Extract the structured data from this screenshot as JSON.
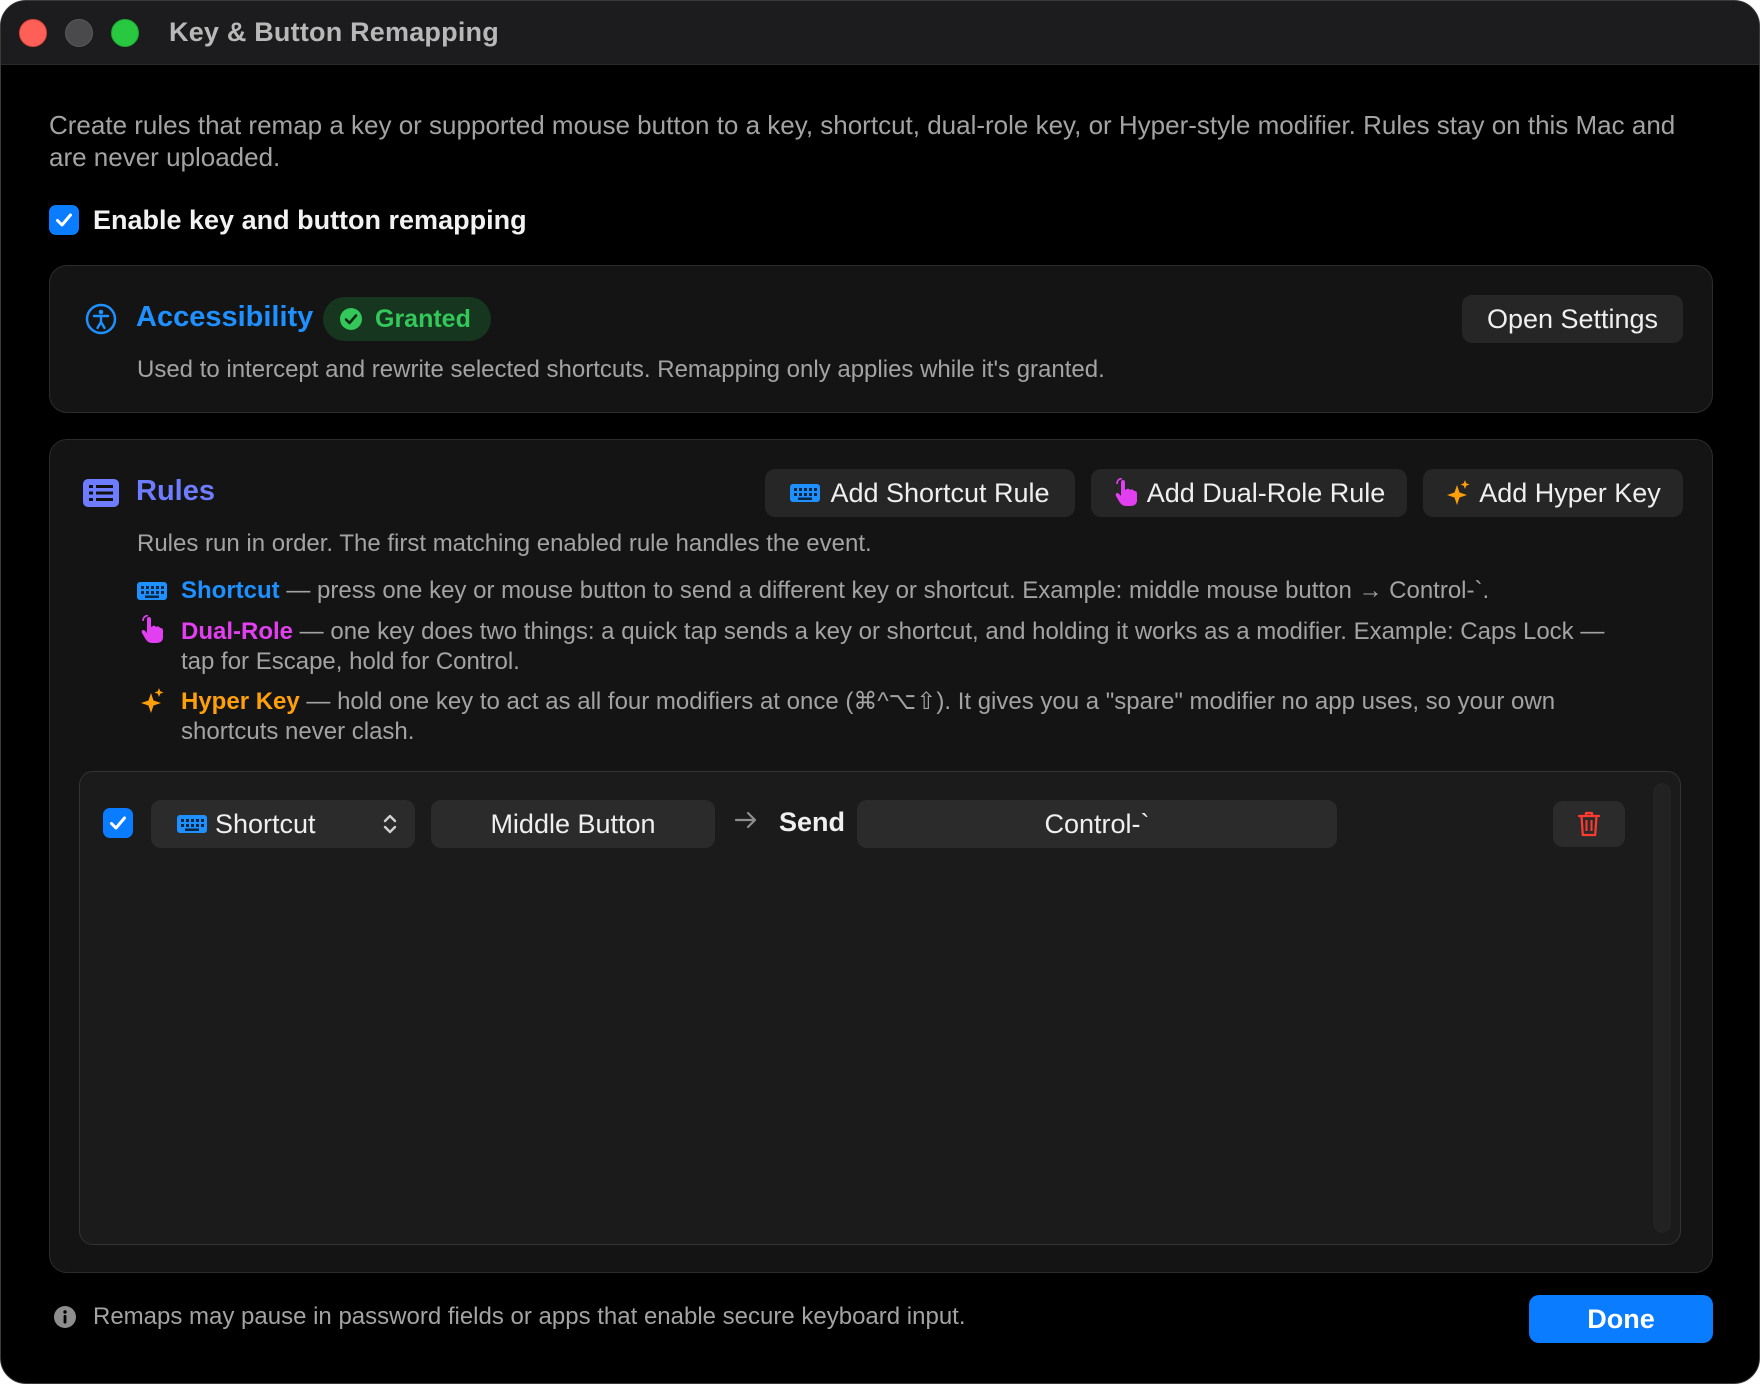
{
  "window": {
    "title": "Key & Button Remapping"
  },
  "intro": {
    "text": "Create rules that remap a key or supported mouse button to a key, shortcut, dual-role key, or Hyper-style modifier. Rules stay on this Mac and are never uploaded."
  },
  "enable": {
    "label": "Enable key and button remapping",
    "checked": true
  },
  "accessibility": {
    "title": "Accessibility",
    "status": "Granted",
    "description": "Used to intercept and rewrite selected shortcuts. Remapping only applies while it's granted.",
    "open_settings_label": "Open Settings"
  },
  "rules": {
    "title": "Rules",
    "add_shortcut_label": "Add Shortcut Rule",
    "add_dual_role_label": "Add Dual-Role Rule",
    "add_hyper_label": "Add Hyper Key",
    "description": "Rules run in order. The first matching enabled rule handles the event.",
    "legend": {
      "shortcut_name": "Shortcut",
      "shortcut_text": " — press one key or mouse button to send a different key or shortcut. Example: middle mouse button → Control-`.",
      "dual_name": "Dual-Role",
      "dual_text_1": " — one key does two things: a quick tap sends a key or shortcut, and holding it works as a modifier. Example: Caps Lock —",
      "dual_text_2": "tap for Escape, hold for Control.",
      "hyper_name": "Hyper Key",
      "hyper_text_1": " — hold one key to act as all four modifiers at once (⌘^⌥⇧). It gives you a \"spare\" modifier no app uses, so your own",
      "hyper_text_2": "shortcuts never clash."
    },
    "items": [
      {
        "enabled": true,
        "type": "Shortcut",
        "trigger": "Middle Button",
        "send_label": "Send",
        "output": "Control-`"
      }
    ]
  },
  "footer": {
    "note": "Remaps may pause in password fields or apps that enable secure keyboard input.",
    "done_label": "Done"
  },
  "colors": {
    "accent": "#0a7cff",
    "shortcut": "#1e90ff",
    "dual_role": "#e23ff0",
    "hyper": "#ff9f0a",
    "granted": "#34c759",
    "danger": "#ff3b30"
  },
  "icons": {
    "accessibility": "accessibility-icon",
    "granted": "checkmark-circle-icon",
    "rules": "list-icon",
    "shortcut": "keyboard-icon",
    "dual_role": "hand-tap-icon",
    "hyper": "sparkles-icon",
    "type_select": "chevron-up-down-icon",
    "arrow": "arrow-right-icon",
    "delete": "trash-icon",
    "info": "info-circle-icon"
  }
}
